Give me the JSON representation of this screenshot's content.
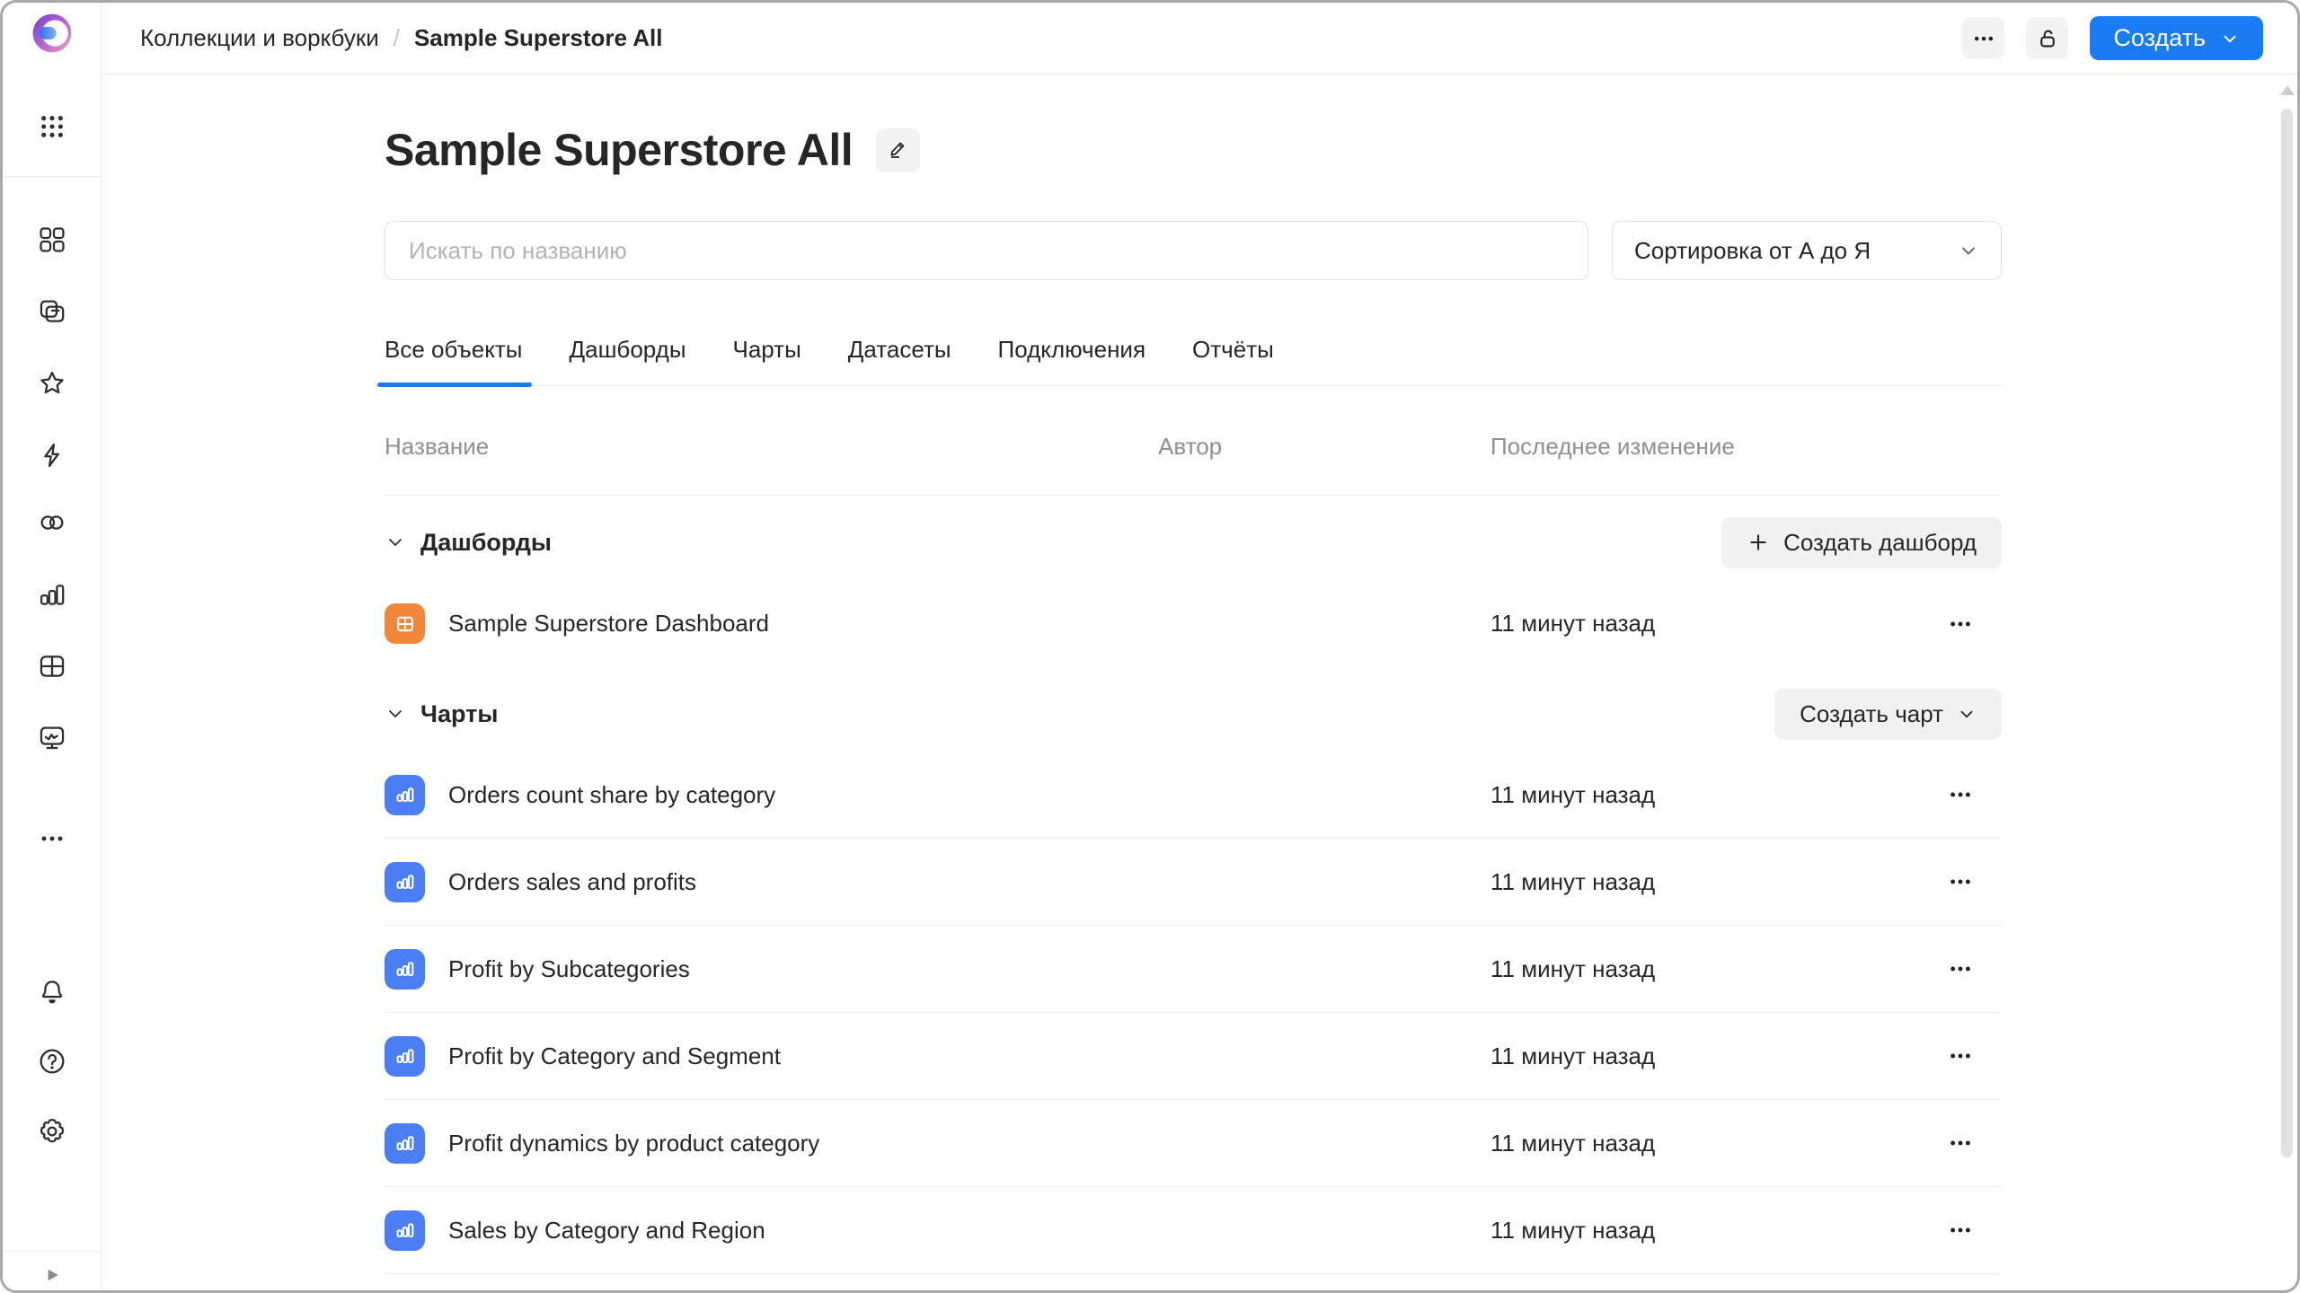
{
  "topbar": {
    "breadcrumb": {
      "parent": "Коллекции и воркбуки",
      "separator": "/",
      "current": "Sample Superstore All"
    },
    "create_label": "Создать"
  },
  "sidebar": {
    "icons": [
      "datalens-logo",
      "apps-grid",
      "objects-grid",
      "collections",
      "favorites-star",
      "quick-actions-lightning",
      "connections-circles",
      "charts-bar",
      "datasets-table",
      "monitoring-screen",
      "more-ellipsis",
      "notifications-bell",
      "help-question",
      "settings-gear",
      "expand-play"
    ]
  },
  "page": {
    "title": "Sample Superstore All",
    "search": {
      "placeholder": "Искать по названию"
    },
    "sort": {
      "value": "Сортировка от А до Я"
    },
    "tabs": [
      {
        "label": "Все объекты",
        "active": true
      },
      {
        "label": "Дашборды"
      },
      {
        "label": "Чарты"
      },
      {
        "label": "Датасеты"
      },
      {
        "label": "Подключения"
      },
      {
        "label": "Отчёты"
      }
    ],
    "table": {
      "headers": [
        "Название",
        "Автор",
        "Последнее изменение"
      ]
    },
    "sections": [
      {
        "title": "Дашборды",
        "action": {
          "label": "Создать дашборд",
          "icon": "plus"
        },
        "rows": [
          {
            "icon": "dashboard",
            "title": "Sample Superstore Dashboard",
            "modified": "11 минут назад"
          }
        ]
      },
      {
        "title": "Чарты",
        "action": {
          "label": "Создать чарт",
          "icon": "chevron-down"
        },
        "rows": [
          {
            "icon": "chart",
            "title": "Orders count share by category",
            "modified": "11 минут назад"
          },
          {
            "icon": "chart",
            "title": "Orders sales and profits",
            "modified": "11 минут назад"
          },
          {
            "icon": "chart",
            "title": "Profit by Subcategories",
            "modified": "11 минут назад"
          },
          {
            "icon": "chart",
            "title": "Profit by Category and Segment",
            "modified": "11 минут назад"
          },
          {
            "icon": "chart",
            "title": "Profit dynamics by product category",
            "modified": "11 минут назад"
          },
          {
            "icon": "chart",
            "title": "Sales by Category and Region",
            "modified": "11 минут назад"
          }
        ]
      }
    ]
  },
  "colors": {
    "primary_blue": "#1a7cf2",
    "chart_icon_blue": "#4c7ef3",
    "dashboard_icon_orange": "#f0873b",
    "author_placeholder": "#eef1f7"
  }
}
